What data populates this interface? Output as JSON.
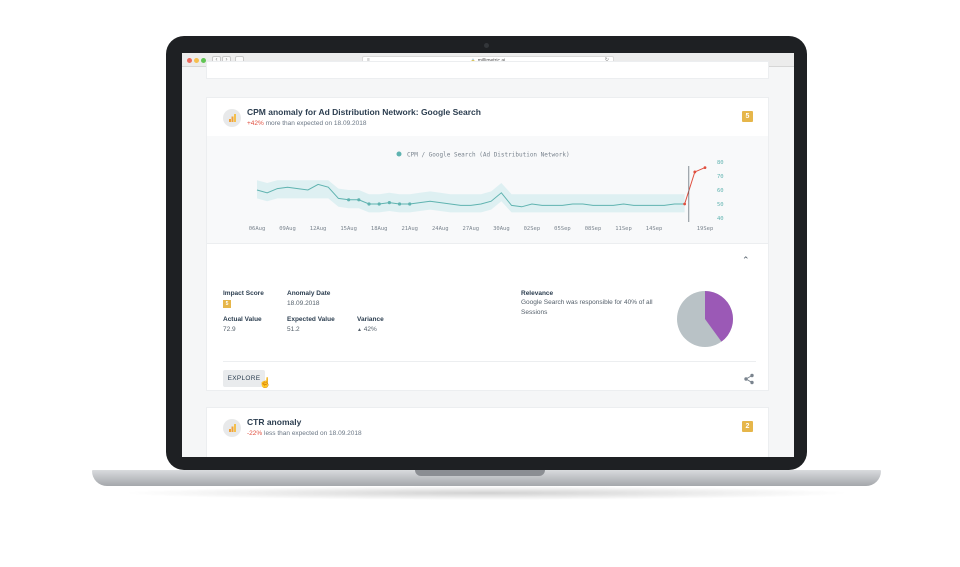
{
  "browser": {
    "url": "millimetric.ai",
    "lock_icon": "lock-icon",
    "reload_icon": "reload-icon"
  },
  "anomaly_main": {
    "title": "CPM anomaly for Ad Distribution Network: Google Search",
    "change": "+42%",
    "subtitle_rest": " more than expected on 18.09.2018",
    "score": "5",
    "chart_data": {
      "type": "line",
      "legend": "CPM / Google Search (Ad Distribution Network)",
      "x_ticks": [
        "06Aug",
        "09Aug",
        "12Aug",
        "15Aug",
        "18Aug",
        "21Aug",
        "24Aug",
        "27Aug",
        "30Aug",
        "02Sep",
        "05Sep",
        "08Sep",
        "11Sep",
        "14Sep",
        "19Sep"
      ],
      "y_ticks": [
        "40",
        "50",
        "60",
        "70",
        "80"
      ],
      "ylim": [
        40,
        80
      ],
      "series": [
        {
          "color": "#5fb3b0",
          "x": [
            "06Aug",
            "07Aug",
            "08Aug",
            "09Aug",
            "10Aug",
            "11Aug",
            "12Aug",
            "13Aug",
            "14Aug",
            "15Aug",
            "16Aug",
            "17Aug",
            "18Aug",
            "19Aug",
            "20Aug",
            "21Aug",
            "22Aug",
            "23Aug",
            "24Aug",
            "25Aug",
            "26Aug",
            "27Aug",
            "28Aug",
            "29Aug",
            "30Aug",
            "31Aug",
            "01Sep",
            "02Sep",
            "03Sep",
            "04Sep",
            "05Sep",
            "06Sep",
            "07Sep",
            "08Sep",
            "09Sep",
            "10Sep",
            "11Sep",
            "12Sep",
            "13Sep",
            "14Sep",
            "15Sep",
            "16Sep",
            "17Sep"
          ],
          "values": [
            60,
            58,
            61,
            62,
            61,
            60,
            64,
            62,
            54,
            53,
            53,
            50,
            50,
            51,
            50,
            50,
            51,
            52,
            51,
            50,
            49,
            49,
            50,
            52,
            58,
            49,
            48,
            50,
            49,
            49,
            49,
            50,
            50,
            49,
            49,
            49,
            50,
            49,
            49,
            49,
            49,
            50,
            50
          ]
        },
        {
          "color": "#e04f3f",
          "x": [
            "17Sep",
            "18Sep",
            "19Sep"
          ],
          "values": [
            50,
            72.9,
            76
          ]
        }
      ],
      "band_color": "#d7eef0"
    }
  },
  "details": {
    "impact_score_label": "Impact Score",
    "impact_score_value": "5",
    "anomaly_date_label": "Anomaly Date",
    "anomaly_date_value": "18.09.2018",
    "actual_value_label": "Actual Value",
    "actual_value": "72.9",
    "expected_value_label": "Expected Value",
    "expected_value": "51.2",
    "variance_label": "Variance",
    "variance_value": "42%",
    "relevance_label": "Relevance",
    "relevance_text": "Google Search was responsible for 40% of all Sessions",
    "relevance_share": 0.4,
    "pie_colors": {
      "share": "#9b59b6",
      "rest": "#b9c2c6"
    },
    "explore_label": "EXPLORE"
  },
  "anomaly_ctr": {
    "title": "CTR anomaly",
    "change": "-22%",
    "subtitle_rest": " less than expected on 18.09.2018",
    "score": "2"
  }
}
